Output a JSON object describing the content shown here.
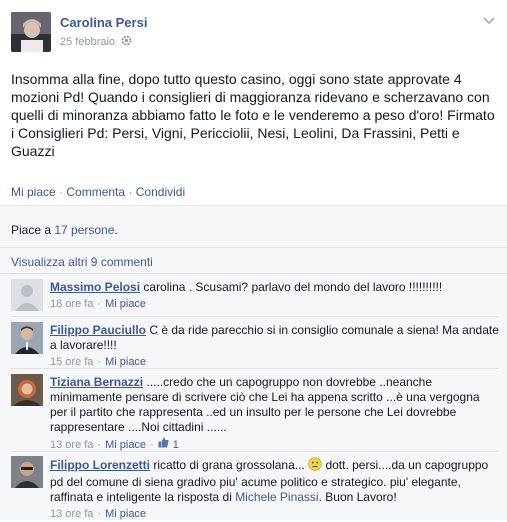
{
  "post": {
    "author": "Carolina Persi",
    "date": "25 febbraio",
    "privacy_icon": "gear-icon",
    "text": "Insomma alla fine, dopo tutto questo casino, oggi sono state approvate 4 mozioni Pd! Quando i consiglieri di maggioranza ridevano e scherzavano con quelli di minoranza abbiamo fatto le foto e le venderemo a peso d'oro! Firmato i Consiglieri Pd: Persi, Vigni, Pericciolii, Nesi, Leolini, Da Frassini, Petti e Guazzi"
  },
  "actions": {
    "like": "Mi piace",
    "sep1": "·",
    "comment": "Commenta",
    "sep2": "·",
    "share": "Condividi"
  },
  "likes": {
    "prefix": "Piace a ",
    "count_link": "17 persone",
    "suffix": "."
  },
  "view_more": "Visualizza altri 9 commenti",
  "comments": [
    {
      "name": "Massimo Pelosi",
      "text": "carolina . Scusami? parlavo del mondo del lavoro !!!!!!!!!!",
      "time": "18 ore fa",
      "like": "Mi piace"
    },
    {
      "name": "Filippo Pauciullo",
      "text": "C è da ride parecchio si in consiglio comunale a siena! Ma andate a lavorare!!!!",
      "time": "15 ore fa",
      "like": "Mi piace"
    },
    {
      "name": "Tiziana Bernazzi",
      "text": ".....credo che un capogruppo non dovrebbe ..neanche minimamente pensare di scrivere ciò che Lei ha appena scritto ...è una vergogna per il partito che rappresenta ..ed un insulto per le persone che Lei dovrebbe rappresentare ....Noi cittadini ......",
      "time": "13 ore fa",
      "like": "Mi piace",
      "like_count": "1"
    },
    {
      "name": "Filippo Lorenzetti",
      "text_before": "ricatto di grana grossolana...",
      "text_after": " dott. persi....da un capogruppo pd del comune di siena gradivo piu' acume politico e strategico. piu' elegante, raffinata e inteligente la risposta di ",
      "mention": "Michele Pinassi",
      "text_end": ". Buon Lavoro!",
      "time": "13 ore fa",
      "like": "Mi piace"
    }
  ],
  "meta_sep": "·"
}
